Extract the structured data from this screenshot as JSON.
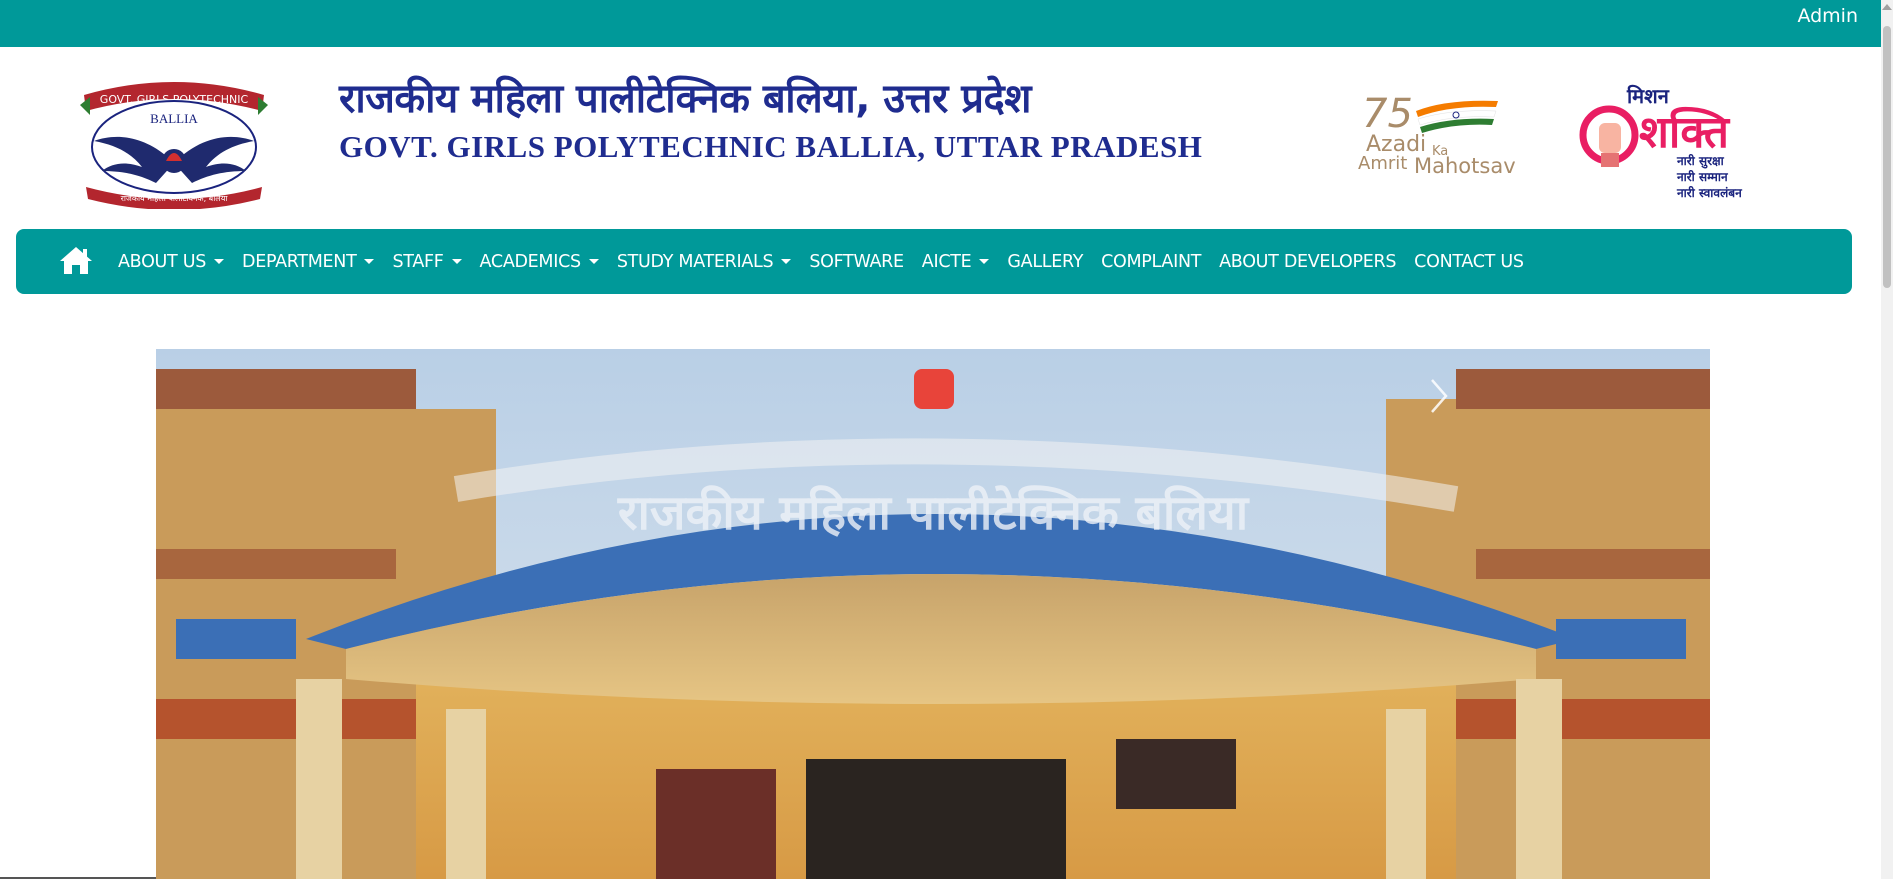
{
  "topbar": {
    "admin_label": "Admin",
    "color": "#009999"
  },
  "header": {
    "title_hindi": "राजकीय महिला पालीटेक्निक बलिया, उत्तर प्रदेश",
    "title_english": "GOVT. GIRLS POLYTECHNIC BALLIA, UTTAR PRADESH",
    "logo": {
      "top_text": "GOVT. GIRLS POLYTECHNIC",
      "center_text": "BALLIA",
      "bottom_text": "राजकीय महिला पालीटेक्निक, बलिया"
    },
    "azadi_logo": {
      "number": "75",
      "line1": "Azadi",
      "ka": "Ka",
      "line2": "Amrit",
      "line3": "Mahotsav"
    },
    "shakti_logo": {
      "top": "मिशन",
      "main": "शक्ति",
      "line1": "नारी सुरक्षा",
      "line2": "नारी सम्मान",
      "line3": "नारी स्वावलंबन"
    }
  },
  "nav": {
    "home_icon": "home-icon",
    "items": [
      {
        "label": "ABOUT US",
        "dropdown": true
      },
      {
        "label": "DEPARTMENT",
        "dropdown": true
      },
      {
        "label": "STAFF",
        "dropdown": true
      },
      {
        "label": "ACADEMICS",
        "dropdown": true
      },
      {
        "label": "STUDY MATERIALS",
        "dropdown": true
      },
      {
        "label": "SOFTWARE",
        "dropdown": false
      },
      {
        "label": "AICTE",
        "dropdown": true
      },
      {
        "label": "GALLERY",
        "dropdown": false
      },
      {
        "label": "COMPLAINT",
        "dropdown": false
      },
      {
        "label": "ABOUT DEVELOPERS",
        "dropdown": false
      },
      {
        "label": "CONTACT US",
        "dropdown": false
      }
    ]
  },
  "carousel": {
    "slide_arch_text": "राजकीय महिला पालीटेक्निक बलिया",
    "prev_icon": "chevron-left-icon",
    "next_icon": "chevron-right-icon"
  }
}
